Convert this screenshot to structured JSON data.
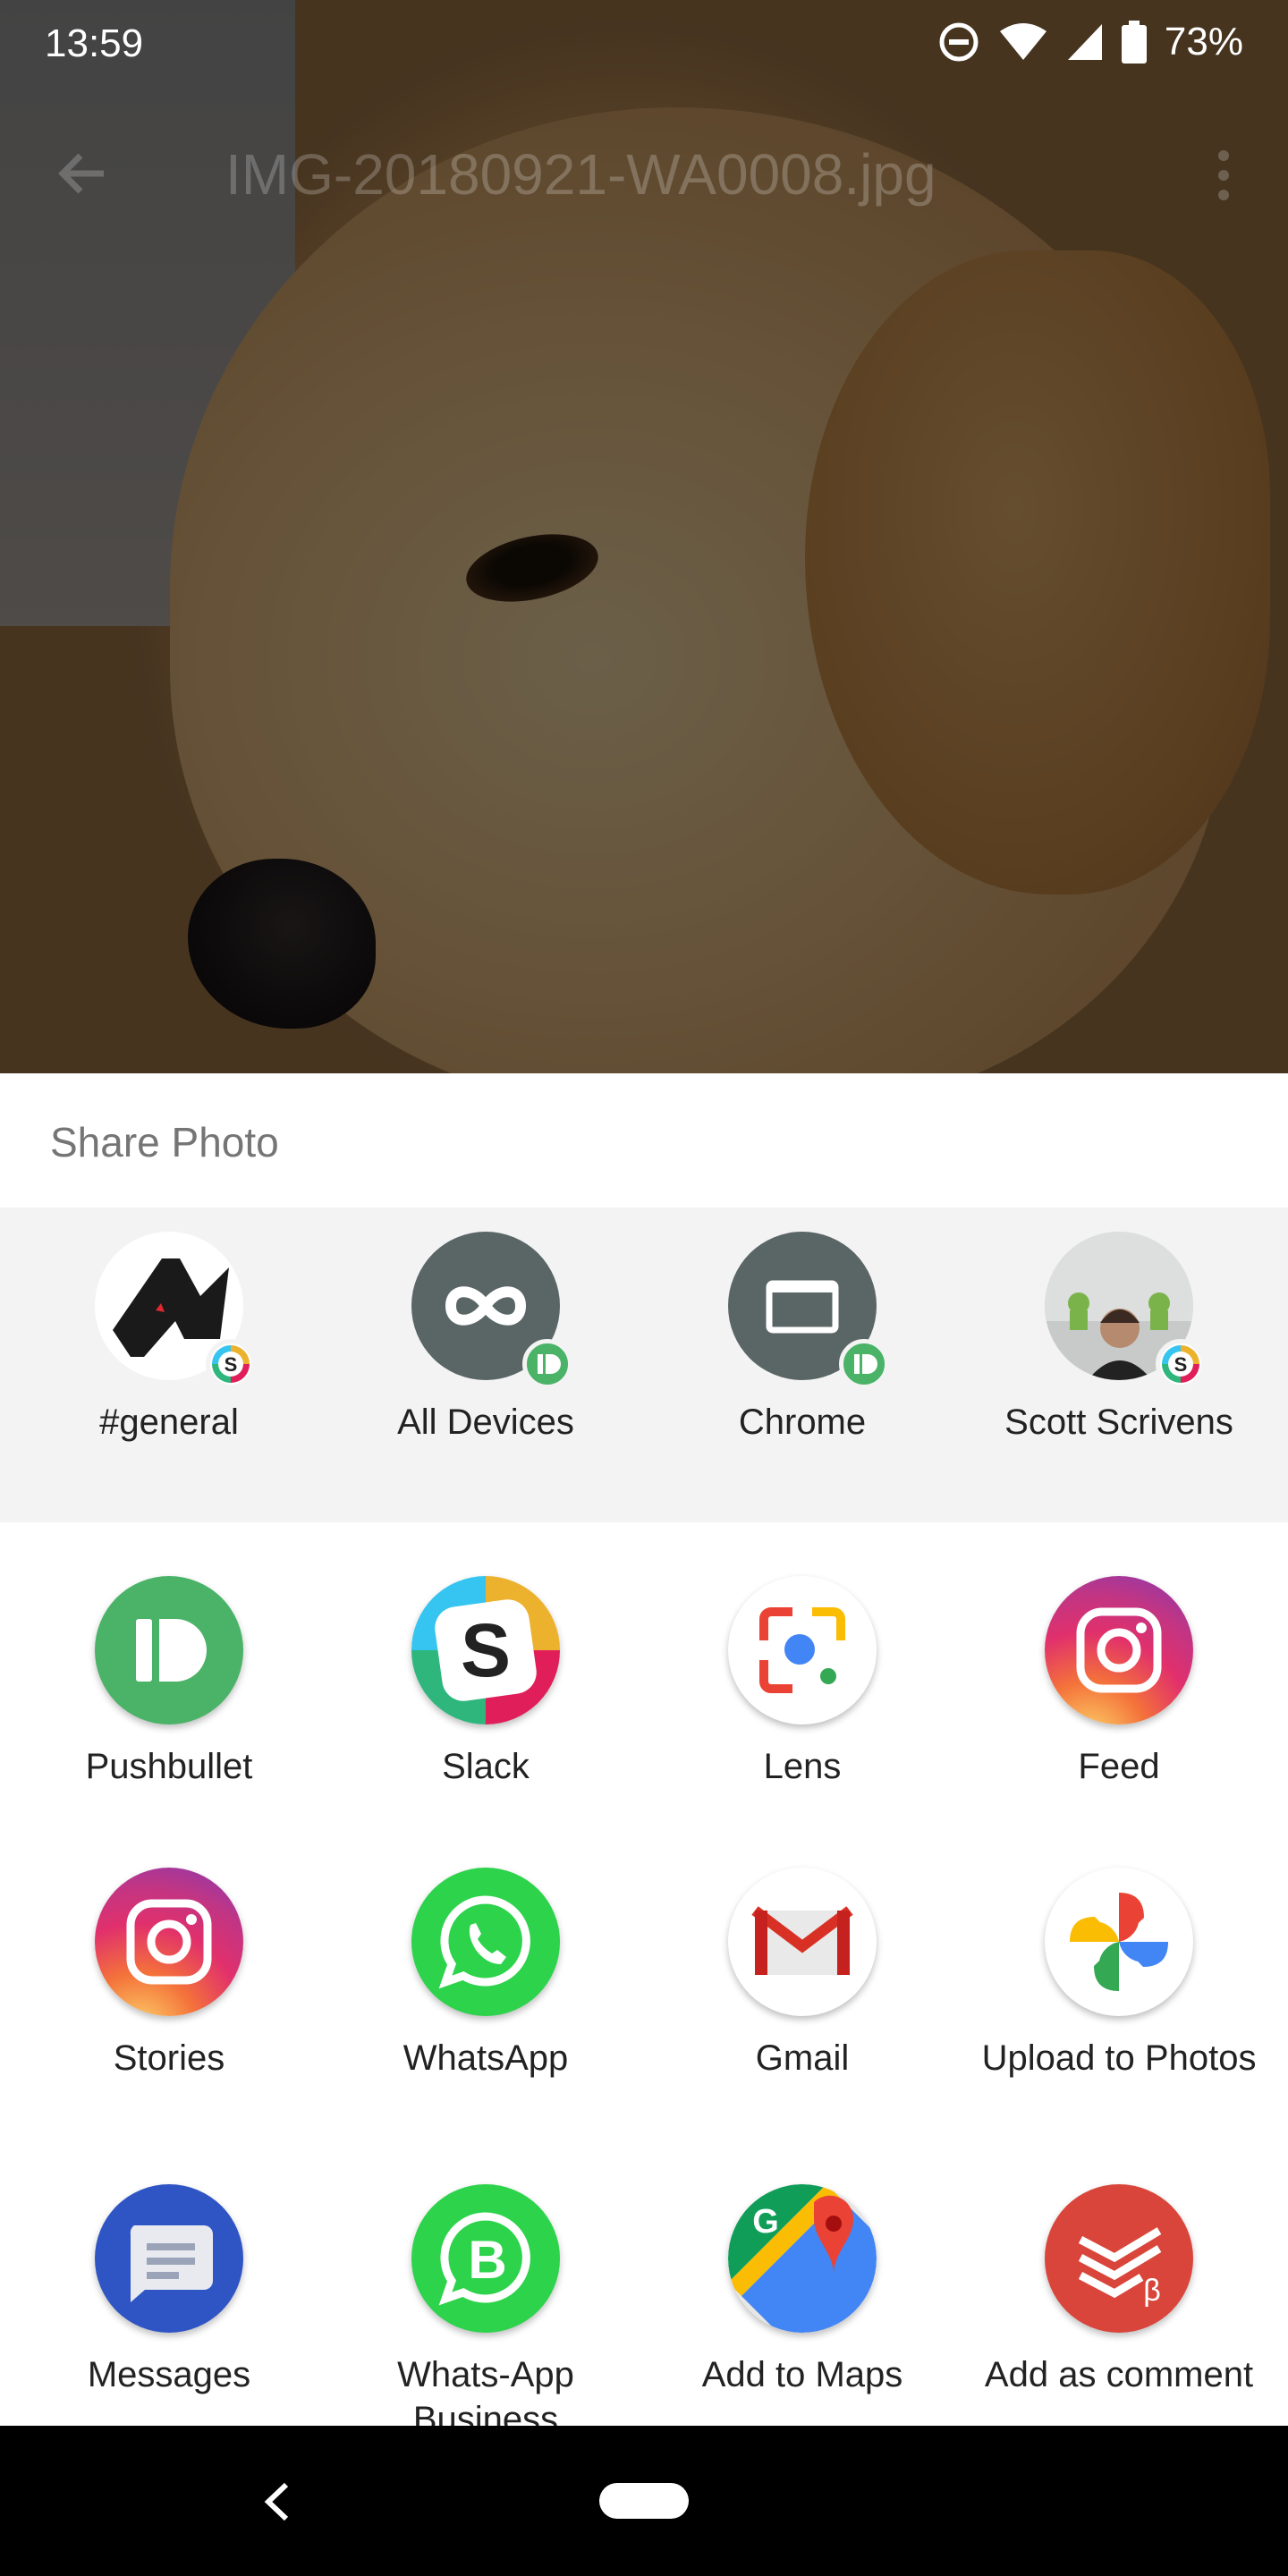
{
  "status_bar": {
    "time": "13:59",
    "battery": "73%"
  },
  "viewer": {
    "title": "IMG-20180921-WA0008.jpg"
  },
  "share_sheet": {
    "title": "Share Photo",
    "direct_targets": [
      {
        "label": "#general",
        "icon": "androidpolice-logo-icon",
        "badge": "slack-badge-icon"
      },
      {
        "label": "All Devices",
        "icon": "infinity-icon",
        "badge": "pushbullet-badge-icon"
      },
      {
        "label": "Chrome",
        "icon": "browser-window-icon",
        "badge": "pushbullet-badge-icon"
      },
      {
        "label": "Scott Scrivens",
        "icon": "contact-photo-icon",
        "badge": "slack-badge-icon"
      }
    ],
    "apps": [
      {
        "label": "Pushbullet",
        "icon": "pushbullet-icon"
      },
      {
        "label": "Slack",
        "icon": "slack-icon"
      },
      {
        "label": "Lens",
        "icon": "lens-icon"
      },
      {
        "label": "Feed",
        "icon": "instagram-icon"
      },
      {
        "label": "Stories",
        "icon": "instagram-icon"
      },
      {
        "label": "WhatsApp",
        "icon": "whatsapp-icon"
      },
      {
        "label": "Gmail",
        "icon": "gmail-icon"
      },
      {
        "label": "Upload to Photos",
        "icon": "google-photos-icon"
      },
      {
        "label": "Messages",
        "icon": "messages-icon"
      },
      {
        "label": "Whats-App Business",
        "icon": "whatsapp-business-icon"
      },
      {
        "label": "Add to Maps",
        "icon": "google-maps-icon"
      },
      {
        "label": "Add as comment",
        "icon": "todoist-icon"
      }
    ]
  },
  "colors": {
    "pushbullet_green": "#4ab367",
    "whatsapp_green": "#2cd34b",
    "messages_blue": "#2f55c5",
    "todoist_red": "#d9453a",
    "slack_aubergine": "#3c1a3f",
    "direct_share_bg": "#f3f3f3"
  }
}
